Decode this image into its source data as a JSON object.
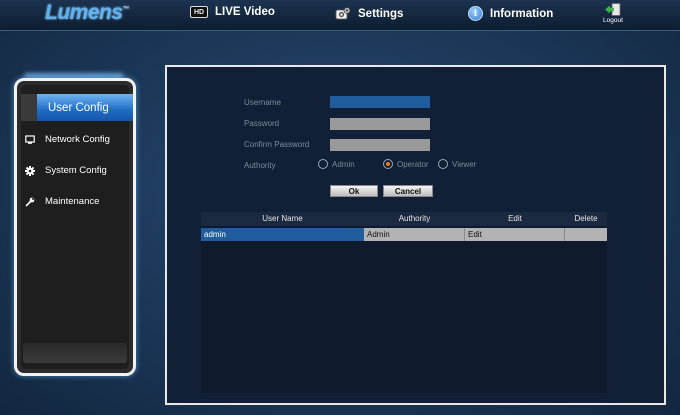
{
  "header": {
    "logo_text": "Lumens",
    "logo_mark": "™",
    "nav": [
      {
        "label": "LIVE Video",
        "icon": "hd-video-icon"
      },
      {
        "label": "Settings",
        "icon": "settings-icon",
        "active": true
      },
      {
        "label": "Information",
        "icon": "info-icon"
      }
    ],
    "hd_badge": "HD",
    "info_badge": "i",
    "logout_label": "Logout"
  },
  "sidebar": {
    "items": [
      {
        "label": "User Config",
        "icon": "",
        "active": true
      },
      {
        "label": "Network Config",
        "icon": "monitor-icon"
      },
      {
        "label": "System Config",
        "icon": "gear-icon"
      },
      {
        "label": "Maintenance",
        "icon": "wrench-icon"
      }
    ]
  },
  "form": {
    "username_label": "Username",
    "username_value": "",
    "password_label": "Password",
    "password_value": "",
    "confirm_label": "Confirm Password",
    "confirm_value": "",
    "authority_label": "Authority",
    "authority_options": [
      "Admin",
      "Operator",
      "Viewer"
    ],
    "authority_selected": "Operator",
    "ok_label": "Ok",
    "cancel_label": "Cancel"
  },
  "table": {
    "columns": [
      "User Name",
      "Authority",
      "Edit",
      "Delete"
    ],
    "rows": [
      {
        "user_name": "admin",
        "authority": "Admin",
        "edit": "Edit",
        "delete": ""
      }
    ]
  },
  "colors": {
    "accent_blue": "#1f6cc5",
    "radio_selected": "#f07a1a"
  }
}
